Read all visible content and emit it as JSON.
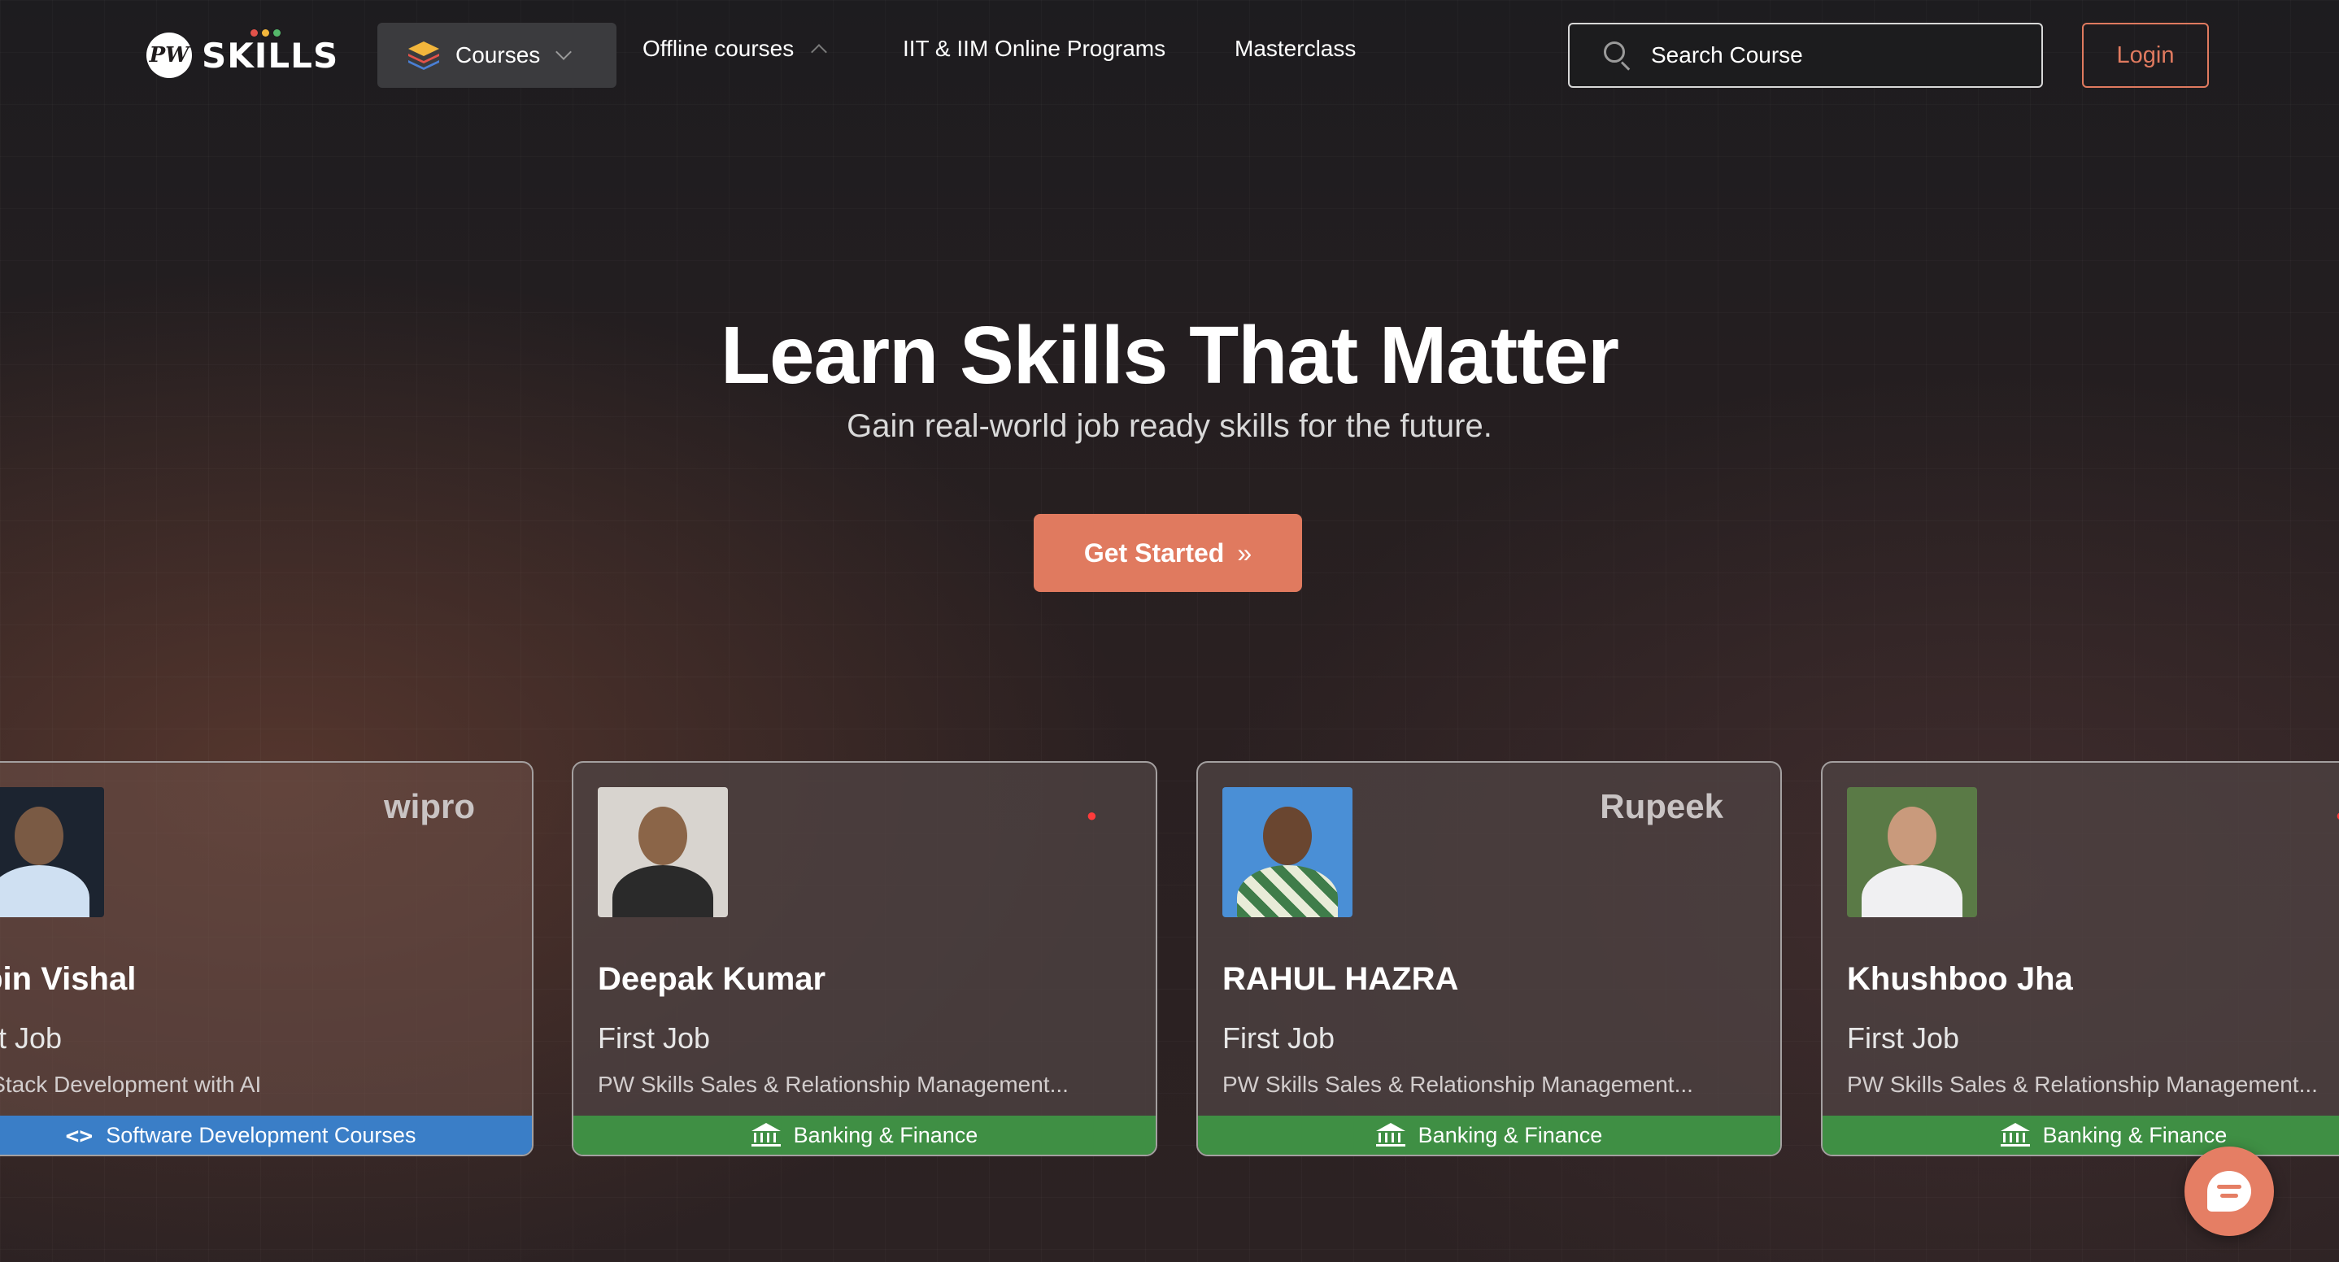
{
  "nav": {
    "logo_mark": "PW",
    "logo_text": "SKILLS",
    "courses_label": "Courses",
    "offline_label": "Offline courses",
    "iit_label": "IIT & IIM Online Programs",
    "masterclass_label": "Masterclass",
    "search_placeholder": "Search Course",
    "login_label": "Login"
  },
  "hero": {
    "title": "Learn Skills That Matter",
    "subtitle": "Gain real-world job ready skills for the future.",
    "cta_label": "Get Started",
    "cta_arrows": "»"
  },
  "cards": [
    {
      "name": "ipin Vishal",
      "role": "rst Job",
      "course": "ll Stack Development with AI",
      "company": "wipro",
      "tag": "Software Development Courses",
      "tag_color": "#3a7ec7"
    },
    {
      "name": "Deepak Kumar",
      "role": "First Job",
      "course": "PW Skills Sales & Relationship Management...",
      "company": "",
      "tag": "Banking & Finance",
      "tag_color": "#3f8f44"
    },
    {
      "name": "RAHUL HAZRA",
      "role": "First Job",
      "course": "PW Skills Sales & Relationship Management...",
      "company": "Rupeek",
      "tag": "Banking & Finance",
      "tag_color": "#3f8f44"
    },
    {
      "name": "Khushboo Jha",
      "role": "First Job",
      "course": "PW Skills Sales & Relationship Management...",
      "company": "",
      "tag": "Banking & Finance",
      "tag_color": "#3f8f44"
    }
  ],
  "colors": {
    "accent": "#e07a5f",
    "background": "#1f1b1c",
    "tag_blue": "#3a7ec7",
    "tag_green": "#3f8f44"
  },
  "icons": {
    "courses": "layers-icon",
    "search": "search-icon",
    "software_tag": "code-icon",
    "finance_tag": "bank-icon",
    "chat": "chat-icon"
  }
}
